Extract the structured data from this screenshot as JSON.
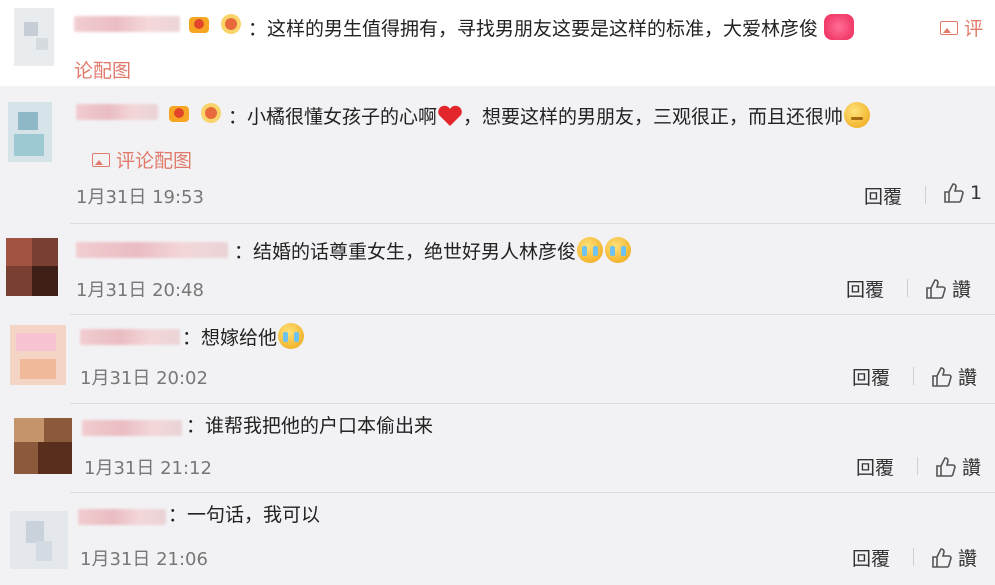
{
  "comments": [
    {
      "text": "：这样的男生值得拥有，寻找男朋友这要是这样的标准，大爱林彦俊",
      "pic_link_a": "评",
      "pic_link_b": "论配图"
    },
    {
      "text_a": "：小橘很懂女孩子的心啊",
      "text_b": "，想要这样的男朋友，三观很正，而且还很帅",
      "pic_link": "评论配图",
      "time": "1月31日 19:53",
      "reply": "回覆",
      "like_count": "1"
    },
    {
      "text": "：结婚的话尊重女生，绝世好男人林彦俊",
      "time": "1月31日 20:48",
      "reply": "回覆",
      "like_label": "讚"
    },
    {
      "text": "：想嫁给他",
      "time": "1月31日 20:02",
      "reply": "回覆",
      "like_label": "讚"
    },
    {
      "text": "：谁帮我把他的户口本偷出来",
      "time": "1月31日 21:12",
      "reply": "回覆",
      "like_label": "讚"
    },
    {
      "text": "：一句话，我可以",
      "time": "1月31日 21:06",
      "reply": "回覆",
      "like_label": "讚"
    }
  ],
  "icons": {
    "like": "thumbs-up-icon",
    "picture": "picture-icon",
    "badge": "member-badge-icon",
    "emoji_cry": "crying-emoji",
    "emoji_heart": "red-heart-emoji",
    "emoji_think": "thinking-emoji",
    "emoji_hug": "heart-hug-emoji"
  },
  "colors": {
    "link": "#e27a6b",
    "background": "#f2f2f5",
    "separator": "#dcdcdc"
  }
}
